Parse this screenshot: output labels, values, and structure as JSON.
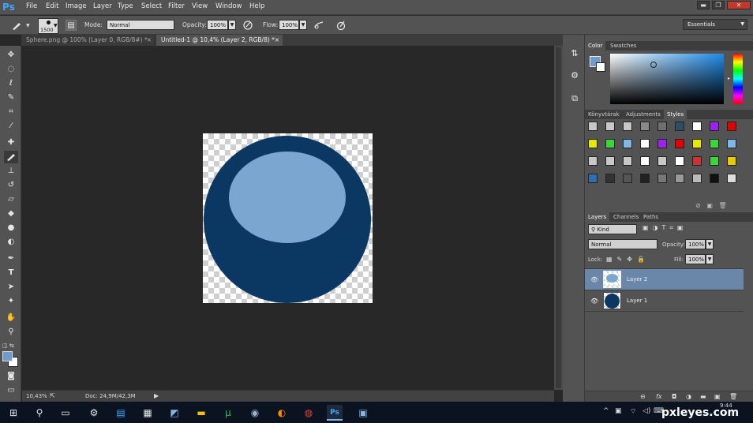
{
  "app": {
    "logo": "Ps"
  },
  "menu": [
    "File",
    "Edit",
    "Image",
    "Layer",
    "Type",
    "Select",
    "Filter",
    "View",
    "Window",
    "Help"
  ],
  "window_controls": {
    "minimize": "▬",
    "restore": "❐",
    "close": "✕"
  },
  "options": {
    "brush_size": "1500",
    "mode_label": "Mode:",
    "mode_value": "Normal",
    "opacity_label": "Opacity:",
    "opacity_value": "100%",
    "flow_label": "Flow:",
    "flow_value": "100%",
    "workspace": "Essentials"
  },
  "doc_tabs": [
    {
      "label": "Sphere.png @ 100% (Layer 0, RGB/8#) *",
      "close": "×"
    },
    {
      "label": "Untitled-1 @ 10,4% (Layer 2, RGB/8) *",
      "close": "×"
    }
  ],
  "status": {
    "zoom": "10,43%",
    "doc": "Doc: 24,9M/42,3M"
  },
  "panels": {
    "color_tabs": [
      "Color",
      "Swatches"
    ],
    "style_tabs": [
      "Könyvtárak",
      "Adjustments",
      "Styles"
    ],
    "layers_tabs": [
      "Layers",
      "Channels",
      "Paths"
    ],
    "kind_label": "Kind",
    "blend_mode": "Normal",
    "opacity_label": "Opacity:",
    "opacity_value": "100%",
    "lock_label": "Lock:",
    "fill_label": "Fill:",
    "fill_value": "100%",
    "layers": [
      {
        "name": "Layer 2",
        "selected": true
      },
      {
        "name": "Layer 1",
        "selected": false
      }
    ],
    "bottom_icons": [
      "⊖",
      "fx",
      "◘",
      "◑",
      "▬",
      "▣",
      "🗑"
    ]
  },
  "colors": {
    "sphere_dark": "#0a3863",
    "sphere_light": "#7ba6cf",
    "foreground": "#6f9ccc",
    "background": "#ffffff",
    "selected_layer": "#6a86a8"
  },
  "styles_grid": [
    [
      "#c8c8c8",
      "#c8c8c8",
      "#c8c8c8",
      "#8a8a8a",
      "#6f6f6f",
      "#2b4d66",
      "#ffffff",
      "#a020f0",
      "#e00000"
    ],
    [
      "#e7e700",
      "#3ad63a",
      "#7fb8e8",
      "#ffffff",
      "#a020f0",
      "#e00000",
      "#e7e700",
      "#3ad63a",
      "#7fb8e8"
    ],
    [
      "#c8c8c8",
      "#c8c8c8",
      "#c8c8c8",
      "#ffffff",
      "#c8c8c8",
      "#ffffff",
      "#cc3333",
      "#3ad63a",
      "#e7c900"
    ],
    [
      "#2f6fb0",
      "#333333",
      "#555555",
      "#222222",
      "#777777",
      "#999999",
      "#bbbbbb",
      "#111111",
      "#dddddd"
    ]
  ],
  "taskbar": {
    "icons": [
      "⊞",
      "⚲",
      "▭",
      "⚙",
      "▤",
      "▦",
      "◩",
      "▬",
      "µ",
      "◉",
      "◐",
      "◍",
      "Ps",
      "▣"
    ],
    "tray": [
      "^",
      "▣",
      "◉",
      "⌔",
      "◁)",
      "⌨"
    ],
    "time": "9:44"
  },
  "watermark": "pxleyes.com"
}
